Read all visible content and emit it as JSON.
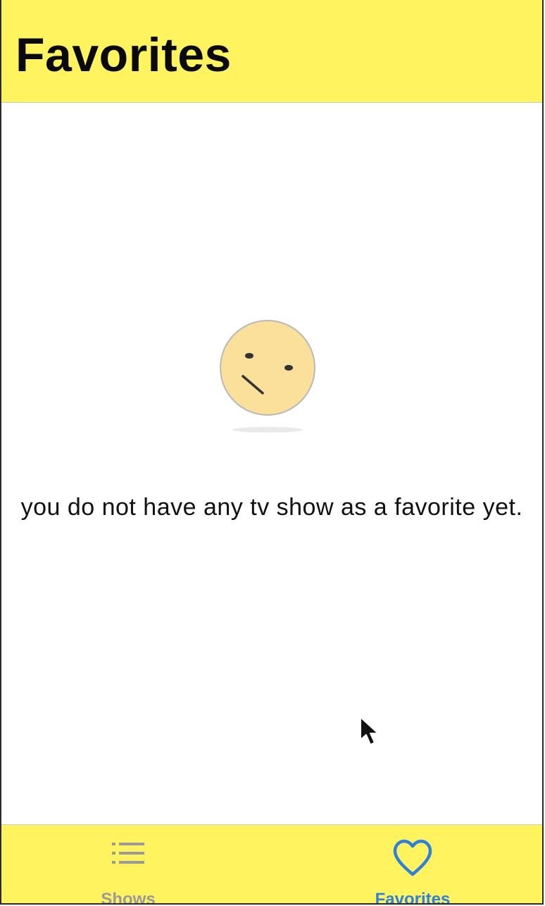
{
  "header": {
    "title": "Favorites"
  },
  "empty_state": {
    "icon": "confused-face-icon",
    "message": "you do not have any tv show as a favorite yet."
  },
  "tabbar": {
    "tabs": [
      {
        "label": "Shows",
        "icon": "list-icon",
        "selected": false
      },
      {
        "label": "Favorites",
        "icon": "heart-icon",
        "selected": true
      }
    ]
  },
  "colors": {
    "bar_background": "#fff45f",
    "accent": "#2f7fdc",
    "inactive": "#9a9a9a",
    "face_fill": "#fbe09c"
  }
}
